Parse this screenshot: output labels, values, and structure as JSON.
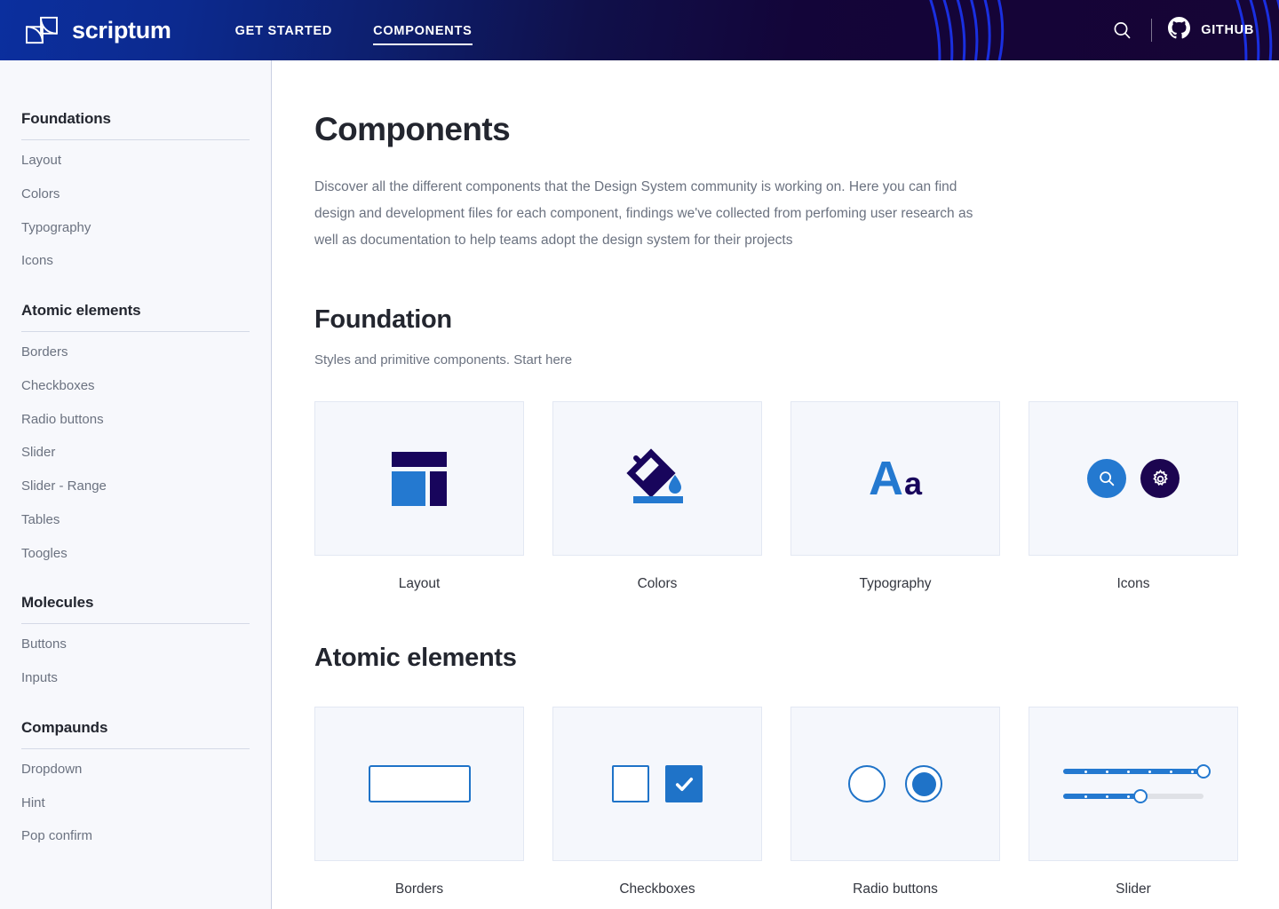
{
  "header": {
    "logo_icon": "scriptum-cube-logo",
    "brand": "scriptum",
    "nav": [
      {
        "label": "GET STARTED",
        "active": false
      },
      {
        "label": "COMPONENTS",
        "active": true
      }
    ],
    "search_icon": "search-icon",
    "github_icon": "github-icon",
    "github_label": "GITHUB",
    "bg_gradient_from": "#0b2f9e",
    "bg_gradient_to": "#160536",
    "arc_color": "#1a2fe0"
  },
  "sidebar": {
    "groups": [
      {
        "title": "Foundations",
        "items": [
          {
            "label": "Layout"
          },
          {
            "label": "Colors"
          },
          {
            "label": "Typography"
          },
          {
            "label": "Icons"
          }
        ]
      },
      {
        "title": "Atomic elements",
        "items": [
          {
            "label": "Borders"
          },
          {
            "label": "Checkboxes"
          },
          {
            "label": "Radio buttons"
          },
          {
            "label": "Slider"
          },
          {
            "label": "Slider - Range"
          },
          {
            "label": "Tables"
          },
          {
            "label": "Toogles"
          }
        ]
      },
      {
        "title": "Molecules",
        "items": [
          {
            "label": "Buttons"
          },
          {
            "label": "Inputs"
          }
        ]
      },
      {
        "title": "Compaunds",
        "items": [
          {
            "label": "Dropdown"
          },
          {
            "label": "Hint"
          },
          {
            "label": "Pop confirm"
          }
        ]
      }
    ]
  },
  "main": {
    "title": "Components",
    "description": "Discover all the different components that the Design System community is working on. Here you can find design and development files for each component, findings we've collected from perfoming user research as well as documentation to help teams adopt the design system for their projects",
    "sections": [
      {
        "title": "Foundation",
        "subtitle": "Styles and primitive components. Start here",
        "cards": [
          {
            "label": "Layout",
            "art": "layout-art"
          },
          {
            "label": "Colors",
            "art": "colors-paint-bucket-art"
          },
          {
            "label": "Typography",
            "art": "typography-Aa-art",
            "glyph_upper": "A",
            "glyph_lower": "a"
          },
          {
            "label": "Icons",
            "art": "icons-search-gear-art"
          }
        ]
      },
      {
        "title": "Atomic elements",
        "subtitle": "",
        "cards": [
          {
            "label": "Borders",
            "art": "border-rectangle-art"
          },
          {
            "label": "Checkboxes",
            "art": "checkbox-pair-art"
          },
          {
            "label": "Radio buttons",
            "art": "radio-pair-art"
          },
          {
            "label": "Slider",
            "art": "slider-pair-art"
          }
        ]
      }
    ]
  },
  "theme": {
    "accent_blue": "#2479d0",
    "deep_navy": "#18055c",
    "sidebar_bg": "#f7f8fc",
    "tile_bg": "#f5f7fc",
    "tile_border": "#e3e8f3",
    "text_dark": "#23262f",
    "text_muted": "#6b7280"
  },
  "slider_values": {
    "top_percent": 100,
    "bottom_percent": 55
  }
}
